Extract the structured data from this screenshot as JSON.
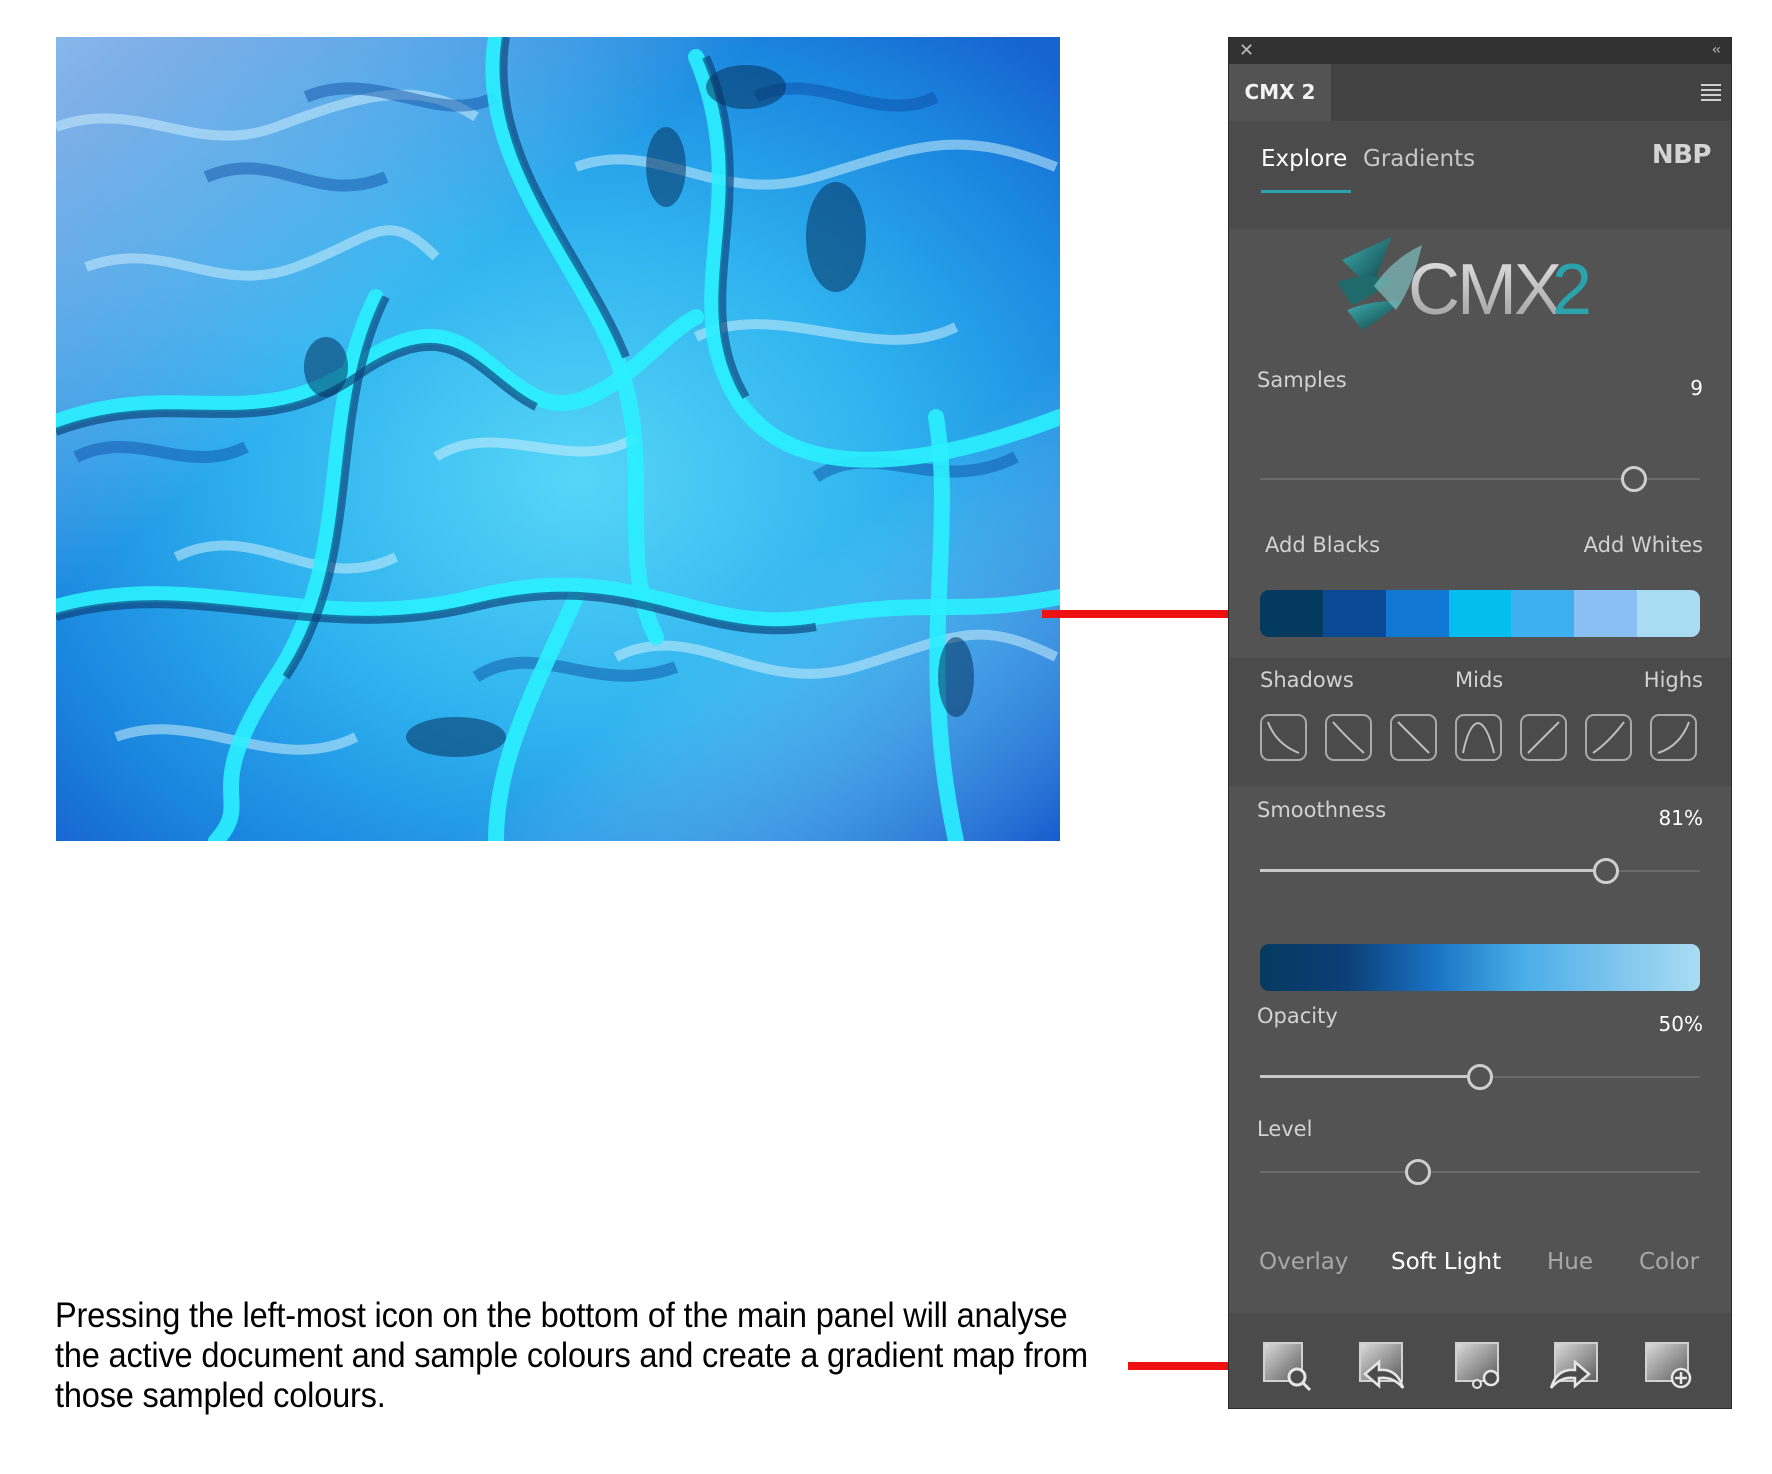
{
  "panel": {
    "tab_name": "CMX 2",
    "tabs": [
      "Explore",
      "Gradients"
    ],
    "brand": "NBP",
    "logo_text": "CMX",
    "logo_digit": "2",
    "samples": {
      "label": "Samples",
      "value": "9",
      "position": 0.85
    },
    "swatches": {
      "left_label": "Add Blacks",
      "right_label": "Add Whites",
      "colors": [
        "#053a60",
        "#0a4994",
        "#1077d2",
        "#05bef0",
        "#3cb0f1",
        "#89bff3",
        "#a9dcf2"
      ]
    },
    "tones": {
      "shadows": "Shadows",
      "mids": "Mids",
      "highs": "Highs"
    },
    "smoothness": {
      "label": "Smoothness",
      "value": "81%",
      "position": 0.787
    },
    "gradient_colors": [
      "#053a60",
      "#0b3f78",
      "#1a73c4",
      "#4aaee8",
      "#7cc4ee",
      "#a9dcf2"
    ],
    "opacity": {
      "label": "Opacity",
      "value": "50%",
      "position": 0.5
    },
    "level": {
      "label": "Level",
      "position": 0.36
    },
    "blend_modes": [
      "Overlay",
      "Soft Light",
      "Hue",
      "Color"
    ],
    "active_blend": "Soft Light",
    "bottom_icons": [
      "analyse-document-icon",
      "import-gradient-icon",
      "settings-icon",
      "export-gradient-icon",
      "new-gradient-icon"
    ]
  },
  "caption": {
    "lines": [
      "Pressing the left-most icon on the bottom of the main panel will analyse",
      "the active document and sample colours and create a gradient map from",
      "those sampled colours."
    ]
  },
  "colors": {
    "arrow": "#ee1111",
    "accent": "#2aa3ad"
  }
}
